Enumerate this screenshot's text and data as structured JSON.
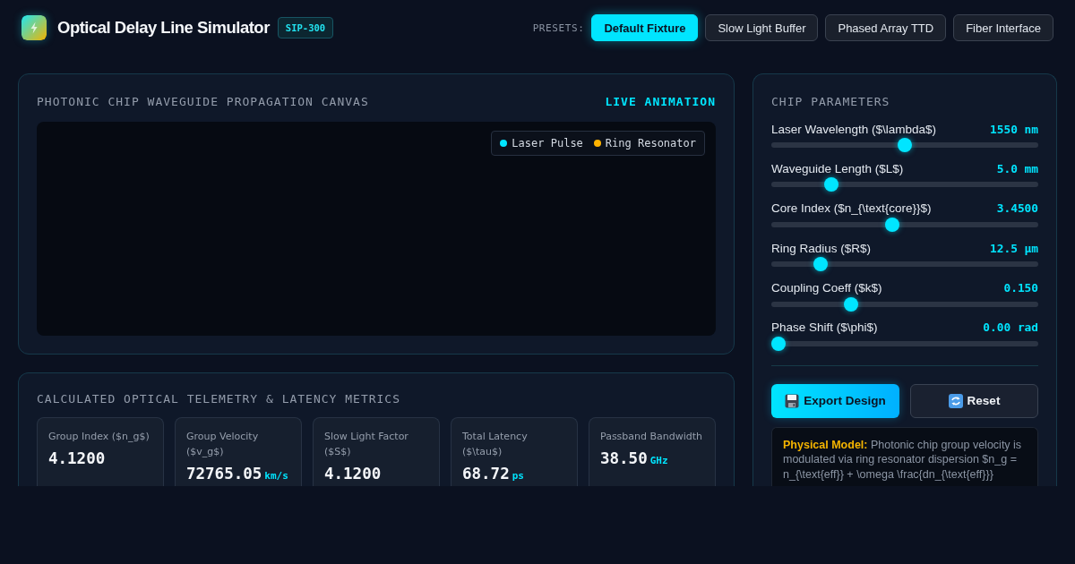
{
  "header": {
    "title": "Optical Delay Line Simulator",
    "badge": "SIP-300",
    "presets_label": "PRESETS:",
    "presets": [
      {
        "label": "Default Fixture",
        "selected": true
      },
      {
        "label": "Slow Light Buffer",
        "selected": false
      },
      {
        "label": "Phased Array TTD",
        "selected": false
      },
      {
        "label": "Fiber Interface",
        "selected": false
      }
    ]
  },
  "canvas_panel": {
    "title": "PHOTONIC CHIP WAVEGUIDE PROPAGATION CANVAS",
    "status": "LIVE ANIMATION",
    "legend": [
      {
        "label": "Laser Pulse",
        "color": "#00e5ff"
      },
      {
        "label": "Ring Resonator",
        "color": "#ffb300"
      }
    ]
  },
  "metrics_panel": {
    "title": "CALCULATED OPTICAL TELEMETRY & LATENCY METRICS",
    "metrics": [
      {
        "label": "Group Index ($n_g$)",
        "value": "4.1200"
      },
      {
        "label": "Group Velocity ($v_g$)",
        "value": "72765.05",
        "unit": "km/s"
      },
      {
        "label": "Slow Light Factor ($S$)",
        "value": "4.1200"
      },
      {
        "label": "Total Latency ($\\tau$)",
        "value": "68.72",
        "unit": "ps"
      },
      {
        "label": "Passband Bandwidth",
        "value": "38.50",
        "unit": "GHz"
      }
    ]
  },
  "parameters_panel": {
    "title": "CHIP PARAMETERS",
    "sliders": [
      {
        "label": "Laser Wavelength ($\\lambda$)",
        "reading": "1550 nm",
        "level": 0.5
      },
      {
        "label": "Waveguide Length ($L$)",
        "reading": "5.0 mm",
        "level": 0.21
      },
      {
        "label": "Core Index ($n_{\\text{core}}$)",
        "reading": "3.4500",
        "level": 0.45
      },
      {
        "label": "Ring Radius ($R$)",
        "reading": "12.5 μm",
        "level": 0.167
      },
      {
        "label": "Coupling Coeff ($k$)",
        "reading": "0.150",
        "level": 0.287
      },
      {
        "label": "Phase Shift ($\\phi$)",
        "reading": "0.00 rad",
        "level": 0
      }
    ],
    "buttons": [
      {
        "label": "Export Design",
        "kind": "export"
      },
      {
        "label": "Reset",
        "kind": "reset"
      }
    ],
    "note": "**Physical Model:** Photonic chip group velocity is modulated via ring resonator dispersion $n_g = n_{\\text{eff}} + \\omega \\frac{dn_{\\text{eff}}}"
  }
}
